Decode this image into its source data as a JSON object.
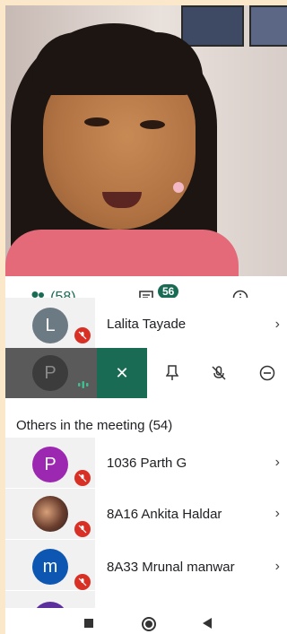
{
  "status_bar": {
    "time": "",
    "right": ""
  },
  "tabs": {
    "people_count": "(58)",
    "chat_badge": "56"
  },
  "top_row": {
    "initial": "L",
    "name": "Lalita Tayade"
  },
  "selected_row": {
    "initial": "P"
  },
  "section_title": "Others in the meeting (54)",
  "participants": [
    {
      "initial": "P",
      "name": "1036 Parth G",
      "avatar_color": "#9c27b0",
      "has_photo": false
    },
    {
      "initial": "",
      "name": "8A16 Ankita Haldar",
      "avatar_color": "#3a2a28",
      "has_photo": true
    },
    {
      "initial": "m",
      "name": "8A33 Mrunal manwar",
      "avatar_color": "#0d57b3",
      "has_photo": false
    }
  ],
  "colors": {
    "accent": "#1a6b54",
    "muted": "#d93025"
  },
  "icons": [
    "people-icon",
    "chat-icon",
    "info-icon",
    "close-icon",
    "pin-icon",
    "mute-icon",
    "remove-icon",
    "chevron-right-icon"
  ]
}
